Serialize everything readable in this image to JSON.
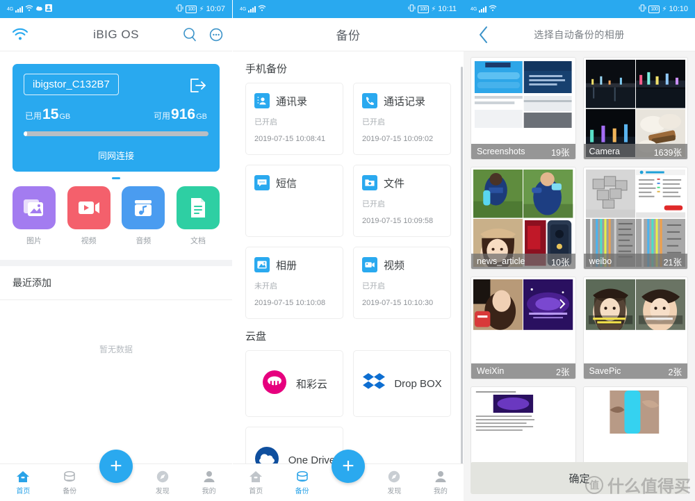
{
  "panels": [
    {
      "status": {
        "time": "10:07",
        "battery": "100",
        "signal_label": "4G"
      },
      "appbar": {
        "title": "iBIG OS",
        "wifi_icon": "wifi-icon",
        "search_icon": "search-icon",
        "more_icon": "more-circle-icon"
      },
      "storage": {
        "device_name": "ibigstor_C132B7",
        "logout_icon": "logout-icon",
        "used_label": "已用",
        "used_value": "15",
        "used_unit": "GB",
        "free_label": "可用",
        "free_value": "916",
        "free_unit": "GB",
        "usage_percent": 2,
        "connection_text": "同网连接"
      },
      "quick_items": [
        {
          "label": "图片",
          "icon": "photos-icon",
          "color": "#a37cf0"
        },
        {
          "label": "视频",
          "icon": "video-icon",
          "color": "#f4606c"
        },
        {
          "label": "音频",
          "icon": "audio-icon",
          "color": "#4a9cf0"
        },
        {
          "label": "文档",
          "icon": "document-icon",
          "color": "#2ecfa3"
        }
      ],
      "recent": {
        "title": "最近添加",
        "empty_text": "暂无数据"
      },
      "nav": [
        {
          "label": "首页",
          "icon": "home-icon",
          "active": true
        },
        {
          "label": "备份",
          "icon": "backup-disk-icon",
          "active": false
        },
        {
          "label": "发现",
          "icon": "compass-icon",
          "active": false
        },
        {
          "label": "我的",
          "icon": "person-icon",
          "active": false
        }
      ],
      "fab": {
        "icon": "plus-icon",
        "label": "+"
      }
    },
    {
      "status": {
        "time": "10:11",
        "battery": "100",
        "signal_label": "4G"
      },
      "appbar": {
        "title": "备份"
      },
      "sections": [
        {
          "title": "手机备份"
        },
        {
          "title": "云盘"
        }
      ],
      "backup_cards": [
        {
          "name": "通讯录",
          "icon": "contacts-icon",
          "state": "已开启",
          "time": "2019-07-15 10:08:41"
        },
        {
          "name": "通话记录",
          "icon": "call-log-icon",
          "state": "已开启",
          "time": "2019-07-15 10:09:02"
        },
        {
          "name": "短信",
          "icon": "sms-icon",
          "state": "",
          "time": ""
        },
        {
          "name": "文件",
          "icon": "file-folder-icon",
          "state": "已开启",
          "time": "2019-07-15 10:09:58"
        },
        {
          "name": "相册",
          "icon": "album-icon",
          "state": "未开启",
          "time": "2019-07-15 10:10:08"
        },
        {
          "name": "视频",
          "icon": "video-camera-icon",
          "state": "已开启",
          "time": "2019-07-15 10:10:30"
        }
      ],
      "cloud_cards": [
        {
          "name": "和彩云",
          "icon": "hecaiyun-icon",
          "color": "#e6007e"
        },
        {
          "name": "Drop BOX",
          "icon": "dropbox-icon",
          "color": "#0d6ed1"
        },
        {
          "name": "One Drive",
          "icon": "onedrive-icon",
          "color": "#0f4f9e"
        }
      ],
      "nav": [
        {
          "label": "首页",
          "icon": "home-icon",
          "active": false
        },
        {
          "label": "备份",
          "icon": "backup-disk-icon",
          "active": true
        },
        {
          "label": "发现",
          "icon": "compass-icon",
          "active": false
        },
        {
          "label": "我的",
          "icon": "person-icon",
          "active": false
        }
      ],
      "fab": {
        "icon": "plus-icon",
        "label": "+"
      }
    },
    {
      "status": {
        "time": "10:10",
        "battery": "100",
        "signal_label": "4G"
      },
      "appbar": {
        "title": "选择自动备份的相册",
        "back_icon": "back-chevron-icon"
      },
      "albums": [
        {
          "name": "Screenshots",
          "count": "19张"
        },
        {
          "name": "Camera",
          "count": "1639张"
        },
        {
          "name": "news_article",
          "count": "10张"
        },
        {
          "name": "weibo",
          "count": "21张"
        },
        {
          "name": "WeiXin",
          "count": "2张"
        },
        {
          "name": "SavePic",
          "count": "2张"
        },
        {
          "name": "",
          "count": ""
        },
        {
          "name": "",
          "count": ""
        }
      ],
      "confirm": {
        "label": "确定"
      },
      "watermark": {
        "mark": "值",
        "text": "什么值得买"
      }
    }
  ],
  "colors": {
    "primary": "#29a9ef",
    "status_bar": "#29a9ef",
    "nav_active": "#2aa3e8",
    "text_muted": "#9aa0a6"
  }
}
